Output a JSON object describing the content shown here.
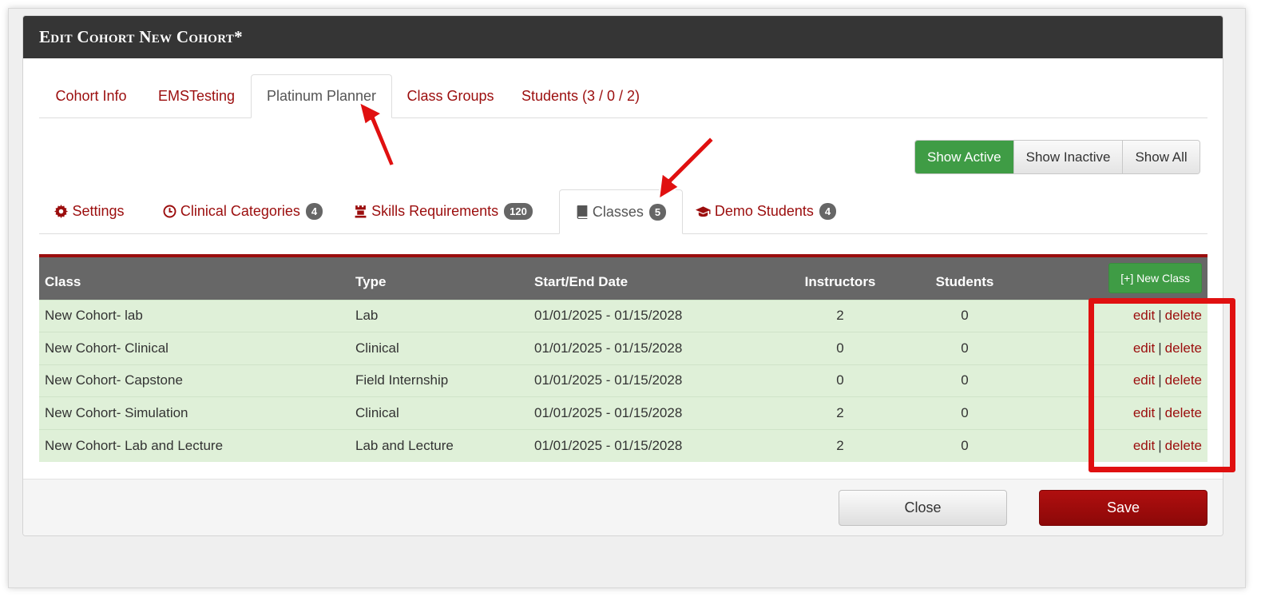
{
  "modal": {
    "title": "Edit Cohort New Cohort*"
  },
  "top_tabs": [
    {
      "label": "Cohort Info",
      "active": false
    },
    {
      "label": "EMSTesting",
      "active": false
    },
    {
      "label": "Platinum Planner",
      "active": true
    },
    {
      "label": "Class Groups",
      "active": false
    },
    {
      "label": "Students (3 / 0 / 2)",
      "active": false
    }
  ],
  "filter": {
    "show_active": "Show Active",
    "show_inactive": "Show Inactive",
    "show_all": "Show All",
    "selected": "Show Active"
  },
  "sub_tabs": [
    {
      "label": "Settings",
      "icon": "gear-icon",
      "badge": null,
      "active": false
    },
    {
      "label": "Clinical Categories",
      "icon": "clock-icon",
      "badge": "4",
      "active": false
    },
    {
      "label": "Skills Requirements",
      "icon": "chess-rook-icon",
      "badge": "120",
      "active": false
    },
    {
      "label": "Classes",
      "icon": "book-icon",
      "badge": "5",
      "active": true
    },
    {
      "label": "Demo Students",
      "icon": "graduation-cap-icon",
      "badge": "4",
      "active": false
    }
  ],
  "table": {
    "columns": {
      "class": "Class",
      "type": "Type",
      "dates": "Start/End Date",
      "instructors": "Instructors",
      "students": "Students"
    },
    "new_class_label": "[+] New Class",
    "edit_label": "edit",
    "separator": "|",
    "delete_label": "delete",
    "rows": [
      {
        "class": "New Cohort- lab",
        "type": "Lab",
        "dates": "01/01/2025 - 01/15/2028",
        "instructors": "2",
        "students": "0"
      },
      {
        "class": "New Cohort- Clinical",
        "type": "Clinical",
        "dates": "01/01/2025 - 01/15/2028",
        "instructors": "0",
        "students": "0"
      },
      {
        "class": "New Cohort- Capstone",
        "type": "Field Internship",
        "dates": "01/01/2025 - 01/15/2028",
        "instructors": "0",
        "students": "0"
      },
      {
        "class": "New Cohort- Simulation",
        "type": "Clinical",
        "dates": "01/01/2025 - 01/15/2028",
        "instructors": "2",
        "students": "0"
      },
      {
        "class": "New Cohort- Lab and Lecture",
        "type": "Lab and Lecture",
        "dates": "01/01/2025 - 01/15/2028",
        "instructors": "2",
        "students": "0"
      }
    ]
  },
  "footer": {
    "close_label": "Close",
    "save_label": "Save"
  },
  "colors": {
    "header_bg": "#353535",
    "accent_red": "#9b0d0d",
    "success_green": "#3f9c45",
    "row_green": "#dff0d8",
    "annotation_red": "#e01010"
  }
}
